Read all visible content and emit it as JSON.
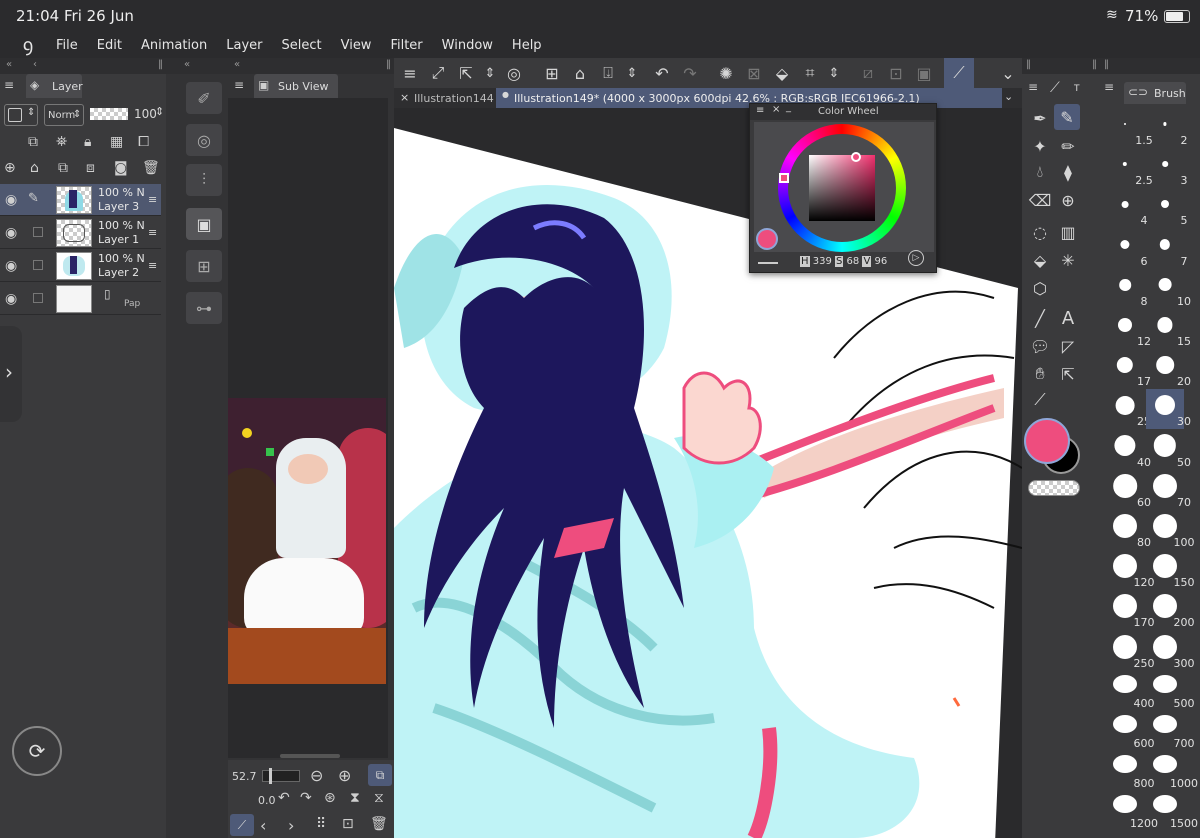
{
  "status": {
    "time": "21:04",
    "date": "Fri 26 Jun",
    "battery": "71%"
  },
  "menu": [
    "File",
    "Edit",
    "Animation",
    "Layer",
    "Select",
    "View",
    "Filter",
    "Window",
    "Help"
  ],
  "layer_panel": {
    "title": "Layer",
    "blend_mode": "Norm",
    "opacity": "100",
    "layers": [
      {
        "opacity": "100 %",
        "mode": "N",
        "name": "Layer 3",
        "selected": true
      },
      {
        "opacity": "100 %",
        "mode": "N",
        "name": "Layer 1",
        "selected": false
      },
      {
        "opacity": "100 %",
        "mode": "N",
        "name": "Layer 2",
        "selected": false
      },
      {
        "opacity": "",
        "mode": "",
        "name": "Pap",
        "selected": false
      }
    ]
  },
  "sub_view": {
    "title": "Sub View",
    "zoom": "52.7",
    "angle": "0.0"
  },
  "document_tabs": [
    {
      "label": "Illustration144",
      "active": false
    },
    {
      "label": "Illustration149* (4000 x 3000px 600dpi 42.6% : RGB:sRGB IEC61966-2.1)",
      "active": true
    }
  ],
  "color_wheel": {
    "title": "Color Wheel",
    "h_label": "H",
    "h": "339",
    "s_label": "S",
    "s": "68",
    "v_label": "V",
    "v": "96",
    "main_color": "#ee4d7e"
  },
  "brush_panel": {
    "title": "Brush",
    "sizes": [
      "1.5",
      "2",
      "2.5",
      "3",
      "4",
      "5",
      "6",
      "7",
      "8",
      "10",
      "12",
      "15",
      "17",
      "20",
      "25",
      "30",
      "40",
      "50",
      "60",
      "70",
      "80",
      "100",
      "120",
      "150",
      "170",
      "200",
      "250",
      "300",
      "400",
      "500",
      "600",
      "700",
      "800",
      "1000",
      "1200",
      "1500"
    ],
    "selected": "30"
  },
  "colors": {
    "accent": "#4e5a78",
    "panel": "#3a3a3c",
    "main_color": "#ee4d7e"
  }
}
